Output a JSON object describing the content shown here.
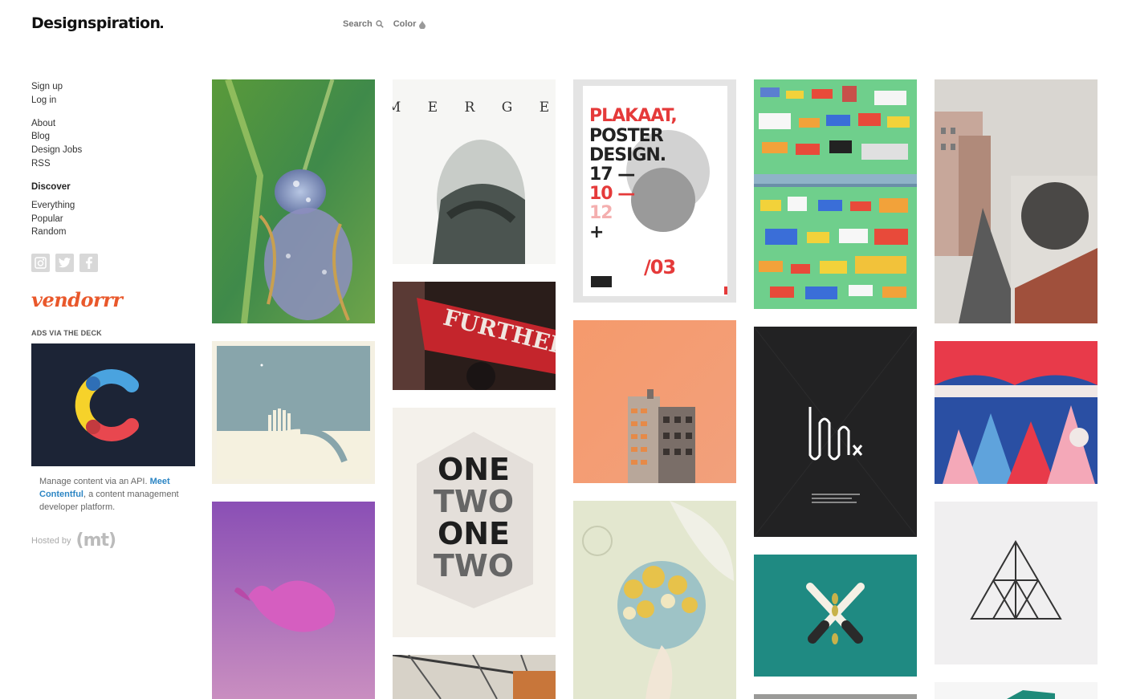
{
  "header": {
    "logo": "Designspiration",
    "nav": [
      {
        "label": "Search",
        "icon": "search-icon"
      },
      {
        "label": "Color",
        "icon": "color-drop-icon"
      }
    ]
  },
  "sidebar": {
    "account": [
      "Sign up",
      "Log in"
    ],
    "info": [
      "About",
      "Blog",
      "Design Jobs",
      "RSS"
    ],
    "discover_heading": "Discover",
    "discover": [
      "Everything",
      "Popular",
      "Random"
    ],
    "social": [
      "instagram-icon",
      "twitter-icon",
      "facebook-icon"
    ],
    "sponsor_logo": "vendorrr"
  },
  "ad": {
    "label": "ADS VIA THE DECK",
    "text_before": "Manage content via an API.",
    "link_text": "Meet Contentful",
    "text_after": ", a content management developer platform."
  },
  "hosted": {
    "label": "Hosted by",
    "logo": "(mt)"
  },
  "colors": {
    "accent_link": "#2d86c4",
    "vendorrr": "#e9582b",
    "ad_bg": "#1c2436"
  },
  "grid": {
    "tiles": [
      {
        "name": "dragonfly-photo"
      },
      {
        "name": "merge-poster",
        "text": "M E R G E"
      },
      {
        "name": "plakaat-poster",
        "text": [
          "PLAKAAT,",
          "POSTER",
          "DESIGN.",
          "17 —",
          "10 —",
          "12",
          "+",
          "/03"
        ]
      },
      {
        "name": "traffic-illustration"
      },
      {
        "name": "street-mural-photo"
      },
      {
        "name": "minimal-landscape-poster"
      },
      {
        "name": "further-bicycle-photo",
        "text": "FURTHER"
      },
      {
        "name": "orange-building-photo"
      },
      {
        "name": "wave-logo-poster"
      },
      {
        "name": "geometric-animals-illustration"
      },
      {
        "name": "whale-poster"
      },
      {
        "name": "one-two-typography-poster",
        "text": [
          "ONE",
          "TWO",
          "ONE",
          "TWO"
        ]
      },
      {
        "name": "flower-head-illustration"
      },
      {
        "name": "scissors-poster"
      },
      {
        "name": "triangle-logo"
      },
      {
        "name": "interior-photo"
      },
      {
        "name": "grey-tile"
      },
      {
        "name": "green-tile"
      }
    ]
  }
}
